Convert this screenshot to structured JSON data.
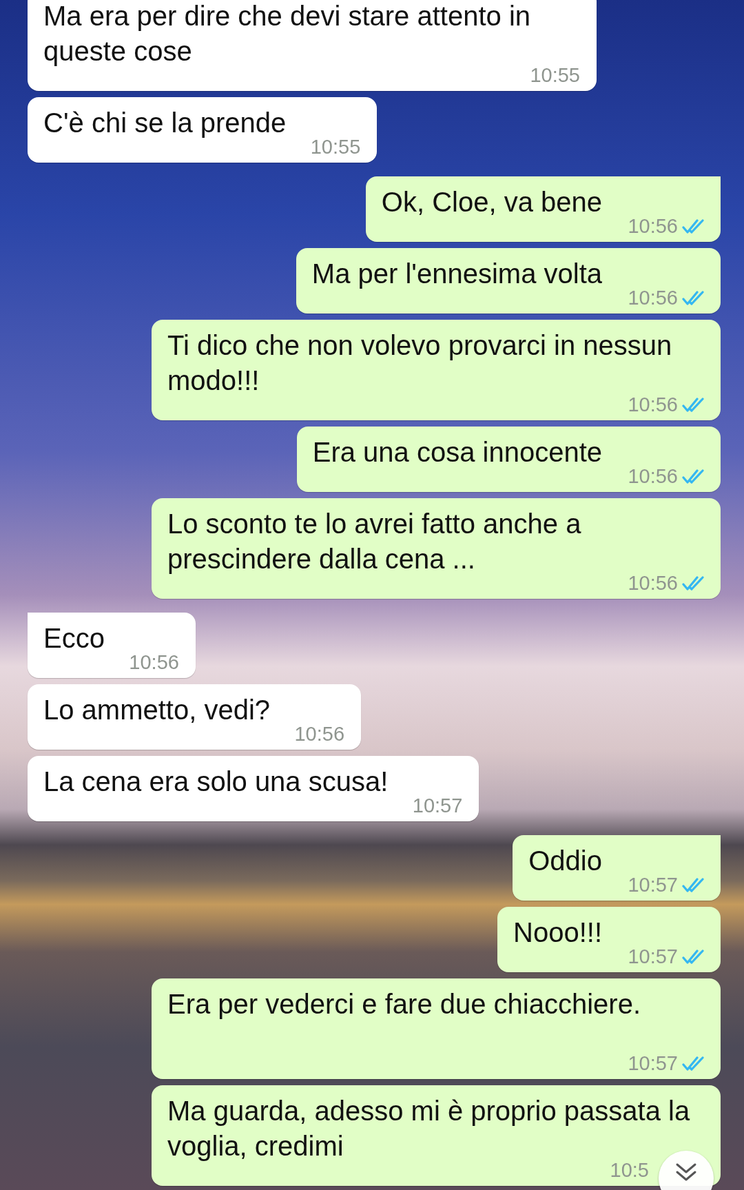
{
  "messages": [
    {
      "kind": "in",
      "text": "Ma era per dire che devi stare attento in queste cose",
      "time": "10:55"
    },
    {
      "kind": "in",
      "tail": false,
      "text": "C'è chi se la prende",
      "time": "10:55"
    },
    {
      "kind": "out",
      "tail": true,
      "text": "Ok, Cloe, va bene",
      "time": "10:56",
      "read": true
    },
    {
      "kind": "out",
      "tail": false,
      "text": "Ma per l'ennesima volta",
      "time": "10:56",
      "read": true
    },
    {
      "kind": "out",
      "tail": false,
      "text": "Ti dico che non volevo provarci in nessun modo!!!",
      "time": "10:56",
      "read": true
    },
    {
      "kind": "out",
      "tail": false,
      "text": "Era una cosa innocente",
      "time": "10:56",
      "read": true
    },
    {
      "kind": "out",
      "tail": false,
      "text": "Lo sconto te lo avrei fatto anche a prescindere dalla cena ...",
      "time": "10:56",
      "read": true
    },
    {
      "kind": "in",
      "tail": true,
      "text": "Ecco",
      "time": "10:56"
    },
    {
      "kind": "in",
      "tail": false,
      "text": "Lo ammetto, vedi?",
      "time": "10:56"
    },
    {
      "kind": "in",
      "tail": false,
      "text": "La cena era solo una scusa!",
      "time": "10:57"
    },
    {
      "kind": "out",
      "tail": true,
      "text": "Oddio",
      "time": "10:57",
      "read": true
    },
    {
      "kind": "out",
      "tail": false,
      "text": "Nooo!!!",
      "time": "10:57",
      "read": true
    },
    {
      "kind": "out",
      "tail": false,
      "text": "Era per vederci e fare due chiacchiere.",
      "time": "10:57",
      "read": true
    },
    {
      "kind": "out",
      "tail": false,
      "text": "Ma guarda, adesso mi è proprio passata la voglia, credimi",
      "time": "10:5"
    }
  ]
}
